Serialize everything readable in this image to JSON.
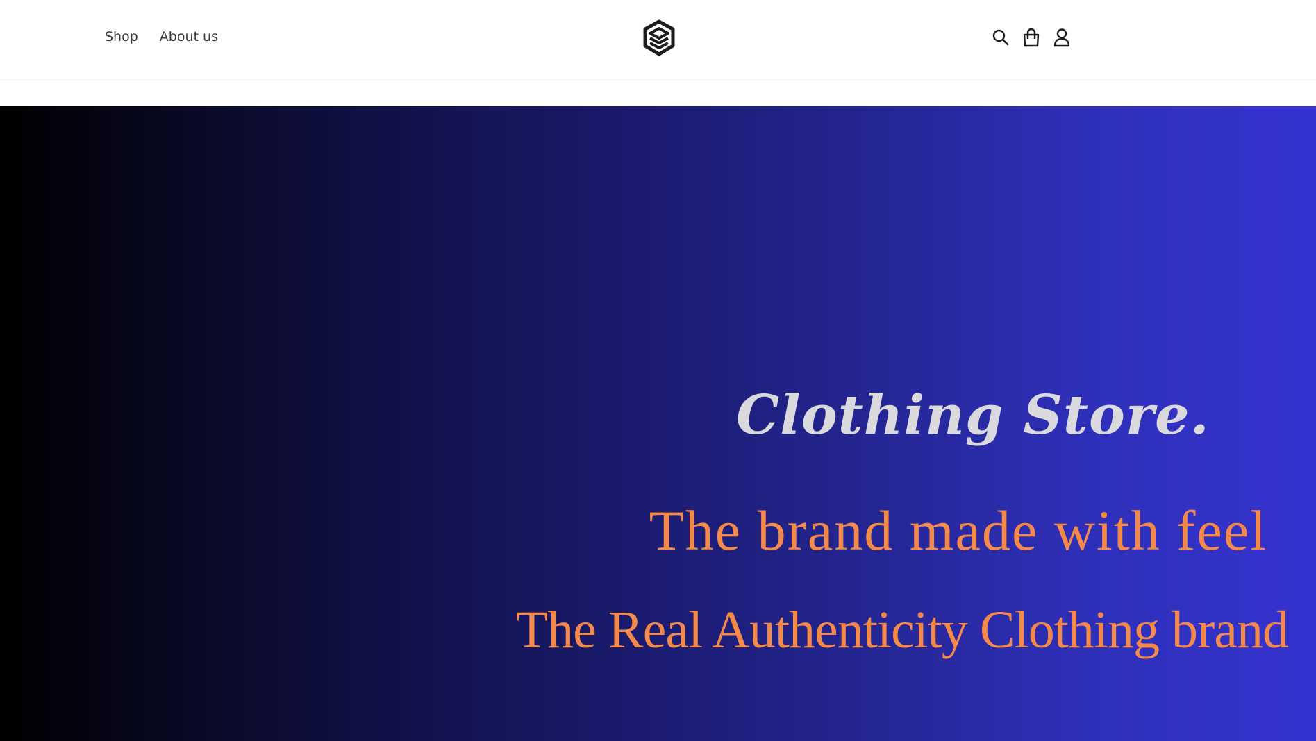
{
  "header": {
    "nav": [
      {
        "label": "Shop"
      },
      {
        "label": "About us"
      }
    ],
    "logo_icon": "stacked-layers-logo-icon",
    "actions": {
      "search_icon": "search-icon",
      "cart_icon": "shopping-bag-icon",
      "account_icon": "user-icon"
    }
  },
  "hero": {
    "title": "Clothing Store.",
    "tagline": "The brand made with feel",
    "subtagline": "The Real Authenticity Clothing brand",
    "colors": {
      "gradient_start": "#000000",
      "gradient_end": "#3533d0",
      "title": "#d9d9de",
      "tagline": "#f5894a"
    }
  }
}
